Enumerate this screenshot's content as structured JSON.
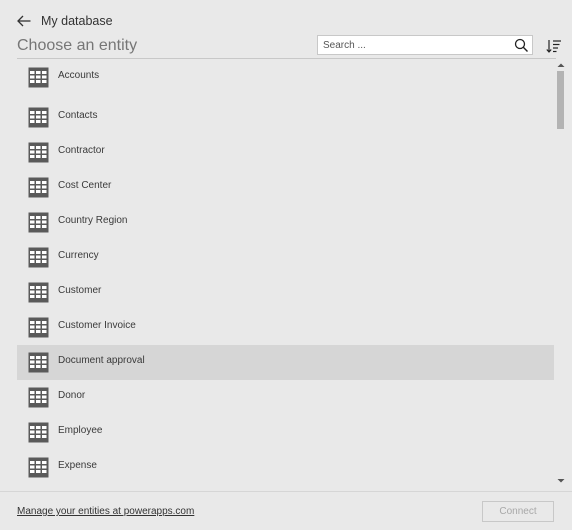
{
  "header": {
    "breadcrumb": "My database",
    "title": "Choose an entity"
  },
  "search": {
    "placeholder": "Search ...",
    "value": ""
  },
  "entities": {
    "items": [
      {
        "label": "Accounts"
      },
      {
        "label": "Contacts"
      },
      {
        "label": "Contractor"
      },
      {
        "label": "Cost Center"
      },
      {
        "label": "Country Region"
      },
      {
        "label": "Currency"
      },
      {
        "label": "Customer"
      },
      {
        "label": "Customer Invoice"
      },
      {
        "label": "Document approval",
        "selected": true
      },
      {
        "label": "Donor"
      },
      {
        "label": "Employee"
      },
      {
        "label": "Expense"
      }
    ]
  },
  "footer": {
    "manage_link": "Manage your entities at powerapps.com",
    "connect_label": "Connect",
    "connect_enabled": false
  },
  "icons": {
    "back": "arrow-left-icon",
    "search": "search-icon",
    "sort": "sort-icon",
    "entity": "table-icon"
  },
  "colors": {
    "background": "#e9e9e9",
    "selected_row": "#d6d6d6",
    "icon": "#5a5a5a",
    "title_text": "#767676",
    "disabled_text": "#a8a8a8"
  }
}
